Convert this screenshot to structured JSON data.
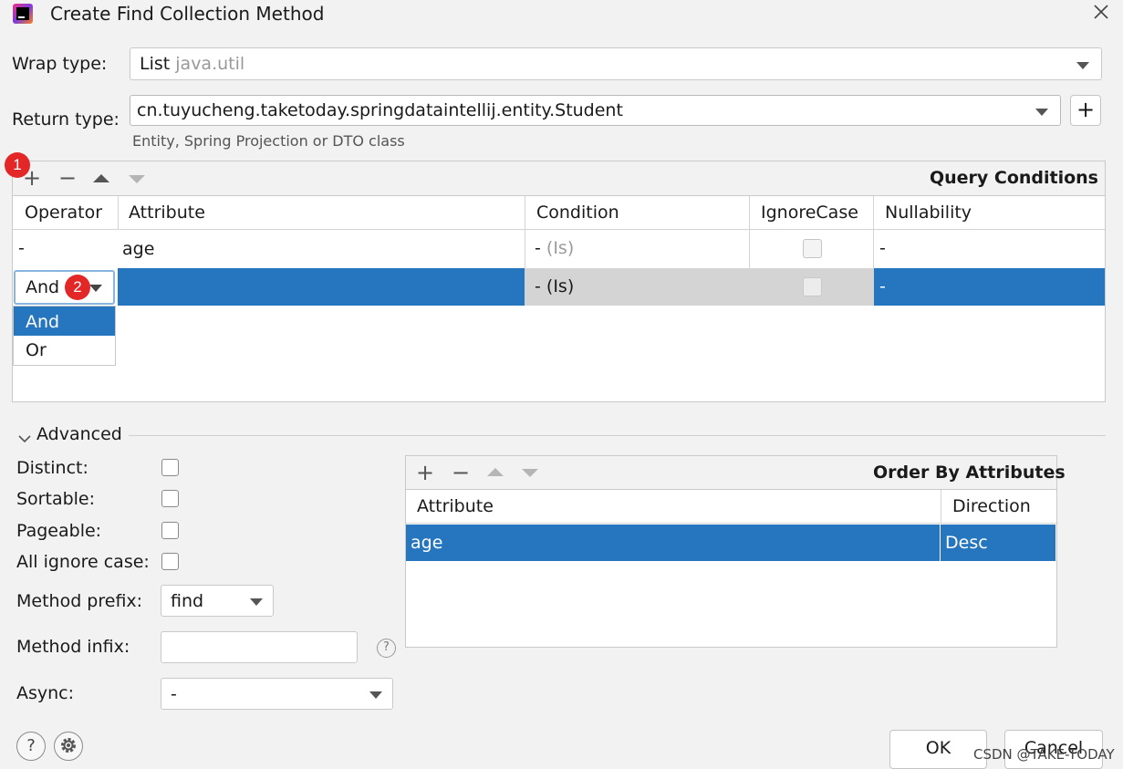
{
  "window": {
    "title": "Create Find Collection Method",
    "app_icon": "intellij-idea-icon",
    "close_icon": "close-icon"
  },
  "wrap_type": {
    "label": "Wrap type:",
    "value": "List",
    "package": "java.util"
  },
  "return_type": {
    "label": "Return type:",
    "value": "cn.tuyucheng.taketoday.springdataintellij.entity.Student",
    "hint": "Entity, Spring Projection or DTO class",
    "add_button": "+"
  },
  "query_conditions": {
    "title": "Query Conditions",
    "toolbar": {
      "add": "+",
      "remove": "−"
    },
    "columns": [
      "Operator",
      "Attribute",
      "Condition",
      "IgnoreCase",
      "Nullability"
    ],
    "rows": [
      {
        "operator": "-",
        "attribute": "age",
        "condition_dash": "-",
        "condition_type": "(Is)",
        "ignore_case": false,
        "nullability": "-"
      },
      {
        "operator": "And",
        "attribute": "",
        "condition_dash": "-",
        "condition_type": "(Is)",
        "ignore_case": false,
        "nullability": "-",
        "selected": true
      }
    ],
    "operator_dropdown": {
      "options": [
        "And",
        "Or"
      ],
      "selected": "And"
    }
  },
  "badges": {
    "b1": "1",
    "b2": "2"
  },
  "advanced": {
    "title": "Advanced",
    "distinct_label": "Distinct:",
    "sortable_label": "Sortable:",
    "pageable_label": "Pageable:",
    "all_ignore_case_label": "All ignore case:",
    "method_prefix_label": "Method prefix:",
    "method_prefix_value": "find",
    "method_infix_label": "Method infix:",
    "method_infix_value": "",
    "async_label": "Async:",
    "async_value": "-",
    "help": "?"
  },
  "order_by": {
    "title": "Order By Attributes",
    "toolbar": {
      "add": "+",
      "remove": "−"
    },
    "columns": [
      "Attribute",
      "Direction"
    ],
    "rows": [
      {
        "attribute": "age",
        "direction": "Desc"
      }
    ]
  },
  "footer": {
    "help": "?",
    "ok": "OK",
    "cancel": "Cancel",
    "watermark": "CSDN @TAKE-TODAY"
  }
}
